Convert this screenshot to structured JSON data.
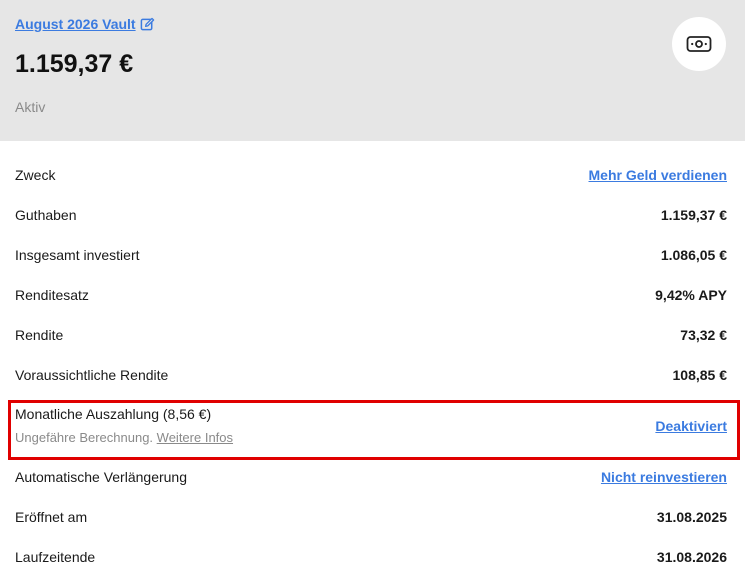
{
  "header": {
    "vault_title": "August 2026 Vault",
    "balance": "1.159,37 €",
    "status": "Aktiv"
  },
  "rows": [
    {
      "label": "Zweck",
      "value": "Mehr Geld verdienen"
    },
    {
      "label": "Guthaben",
      "value": "1.159,37 €"
    },
    {
      "label": "Insgesamt investiert",
      "value": "1.086,05 €"
    },
    {
      "label": "Renditesatz",
      "value": "9,42% APY"
    },
    {
      "label": "Rendite",
      "value": "73,32 €"
    },
    {
      "label": "Voraussichtliche Rendite",
      "value": "108,85 €"
    }
  ],
  "payout": {
    "label": "Monatliche Auszahlung (8,56 €)",
    "note": "Ungefähre Berechnung.",
    "more_info": "Weitere Infos",
    "action": "Deaktiviert"
  },
  "rows2": [
    {
      "label": "Automatische Verlängerung",
      "value": "Nicht reinvestieren"
    },
    {
      "label": "Eröffnet am",
      "value": "31.08.2025"
    },
    {
      "label": "Laufzeitende",
      "value": "31.08.2026"
    }
  ],
  "colors": {
    "accent": "#3b7be0",
    "highlight": "#e00000",
    "header_bg": "#e6e6e6"
  },
  "icons": {
    "edit": "edit-icon",
    "money": "banknote-icon"
  }
}
